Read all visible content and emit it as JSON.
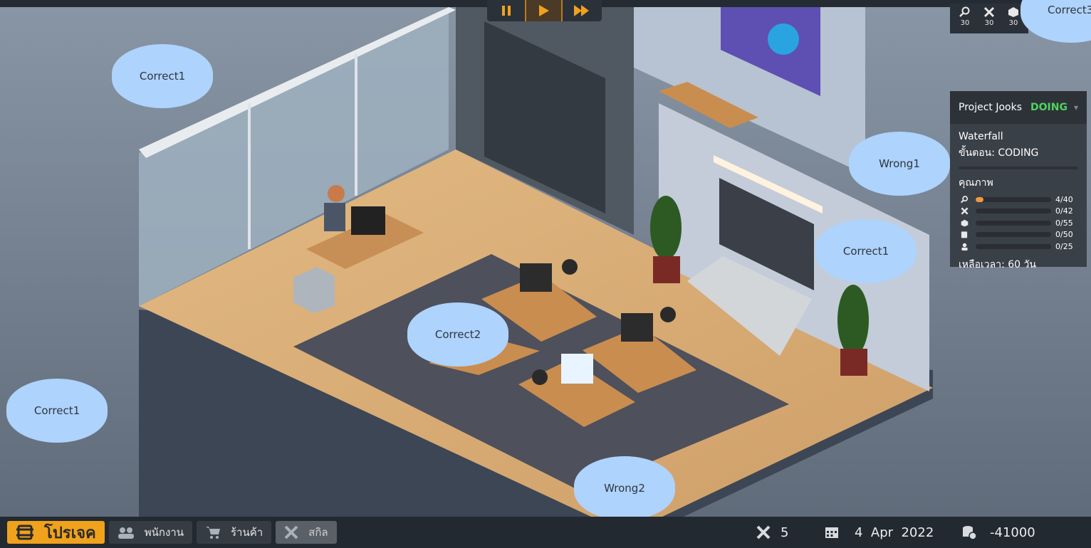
{
  "speed_controls": {
    "pause": "pause-icon",
    "play": "play-icon",
    "fast_forward": "fast-forward-icon"
  },
  "skill_counter": [
    {
      "icon": "search-icon",
      "value": "30"
    },
    {
      "icon": "tools-icon",
      "value": "30"
    },
    {
      "icon": "cube-icon",
      "value": "30"
    }
  ],
  "project": {
    "name": "Project Jooks",
    "status": "DOING",
    "method": "Waterfall",
    "stage": "ขั้นตอน: CODING",
    "quality_label": "คุณภาพ",
    "quality": [
      {
        "icon": "search-icon",
        "text": "4/40",
        "value": 4,
        "max": 40
      },
      {
        "icon": "tools-icon",
        "text": "0/42",
        "value": 0,
        "max": 42
      },
      {
        "icon": "cube-icon",
        "text": "0/55",
        "value": 0,
        "max": 55
      },
      {
        "icon": "clipboard-icon",
        "text": "0/50",
        "value": 0,
        "max": 50
      },
      {
        "icon": "person-icon",
        "text": "0/25",
        "value": 0,
        "max": 25
      }
    ],
    "time_left": "เหลือเวลา: 60 วัน"
  },
  "bubbles": {
    "b1": "Correct1",
    "b2": "Correct1",
    "b3": "Correct1",
    "b4": "Correct2",
    "b5": "Wrong1",
    "b6": "Wrong2",
    "b7": "Correct3"
  },
  "bottom": {
    "tabs": [
      {
        "label": "โปรเจค",
        "icon": "project-icon"
      },
      {
        "label": "พนักงาน",
        "icon": "staff-icon"
      },
      {
        "label": "ร้านค้า",
        "icon": "cart-icon"
      },
      {
        "label": "สกิล",
        "icon": "skill-icon"
      }
    ],
    "tools_count": "5",
    "date": "4  Apr  2022",
    "money": "-41000"
  },
  "colors": {
    "accent": "#f0a21c",
    "status_doing": "#4fd35f",
    "bubble": "#aed3fc",
    "progress": "#f39a3b"
  }
}
